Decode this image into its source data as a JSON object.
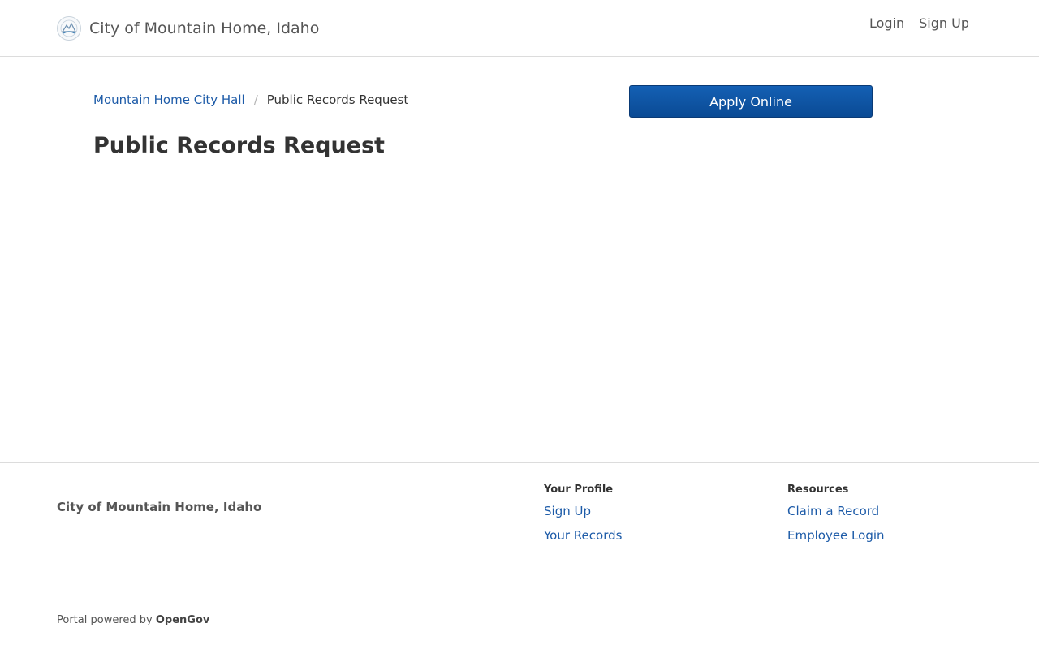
{
  "header": {
    "brand_name": "City of Mountain Home, Idaho",
    "nav": {
      "login": "Login",
      "signup": "Sign Up"
    }
  },
  "breadcrumb": {
    "parent": "Mountain Home City Hall",
    "separator": "/",
    "current": "Public Records Request"
  },
  "apply_button": "Apply Online",
  "page_title": "Public Records Request",
  "footer": {
    "brand_name": "City of Mountain Home, Idaho",
    "profile": {
      "heading": "Your Profile",
      "links": [
        "Sign Up",
        "Your Records"
      ]
    },
    "resources": {
      "heading": "Resources",
      "links": [
        "Claim a Record",
        "Employee Login"
      ]
    },
    "powered_prefix": "Portal powered by",
    "powered_brand": "OpenGov"
  },
  "colors": {
    "link": "#1d5ba8",
    "button": "#0a4a94",
    "text": "#333333"
  },
  "icons": {
    "city_seal": "city-seal-icon"
  }
}
